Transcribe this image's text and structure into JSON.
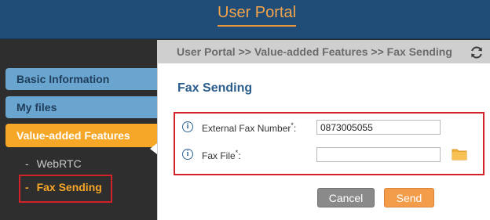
{
  "header": {
    "title": "User Portal"
  },
  "sidebar": {
    "items": [
      {
        "label": "Basic Information"
      },
      {
        "label": "My files"
      },
      {
        "label": "Value-added Features"
      }
    ],
    "subitems": [
      {
        "bullet": "-",
        "label": "WebRTC"
      },
      {
        "bullet": "-",
        "label": "Fax Sending"
      }
    ]
  },
  "main": {
    "breadcrumb": "User Portal >> Value-added Features >> Fax Sending",
    "page_title": "Fax Sending",
    "fields": [
      {
        "label": "External Fax Number",
        "required_mark": "*",
        "colon": ":",
        "value": "0873005055"
      },
      {
        "label": "Fax File",
        "required_mark": "*",
        "colon": ":",
        "value": ""
      }
    ],
    "buttons": {
      "cancel": "Cancel",
      "send": "Send"
    }
  },
  "colors": {
    "header_bg": "#1f4d78",
    "accent_orange": "#f6a727",
    "nav_blue": "#6aa5cf",
    "highlight_red": "#d3222a"
  },
  "icons": [
    "refresh-icon",
    "info-icon",
    "folder-icon"
  ]
}
